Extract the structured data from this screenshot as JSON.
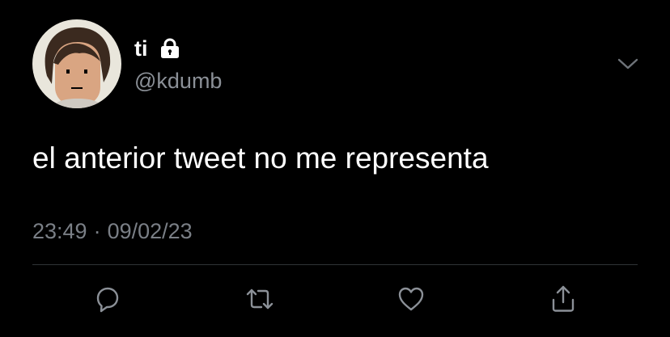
{
  "tweet": {
    "display_name": "ti",
    "handle": "@kdumb",
    "text": "el anterior tweet no me representa",
    "time": "23:49",
    "separator": "·",
    "date": "09/02/23",
    "protected": true
  },
  "icons": {
    "lock": "lock-icon",
    "more": "chevron-down-icon",
    "reply": "reply-icon",
    "retweet": "retweet-icon",
    "like": "heart-icon",
    "share": "share-icon"
  },
  "colors": {
    "background": "#000000",
    "text": "#ffffff",
    "secondary_text": "#8b9097",
    "divider": "#2f3336",
    "icon": "#8b9097"
  }
}
